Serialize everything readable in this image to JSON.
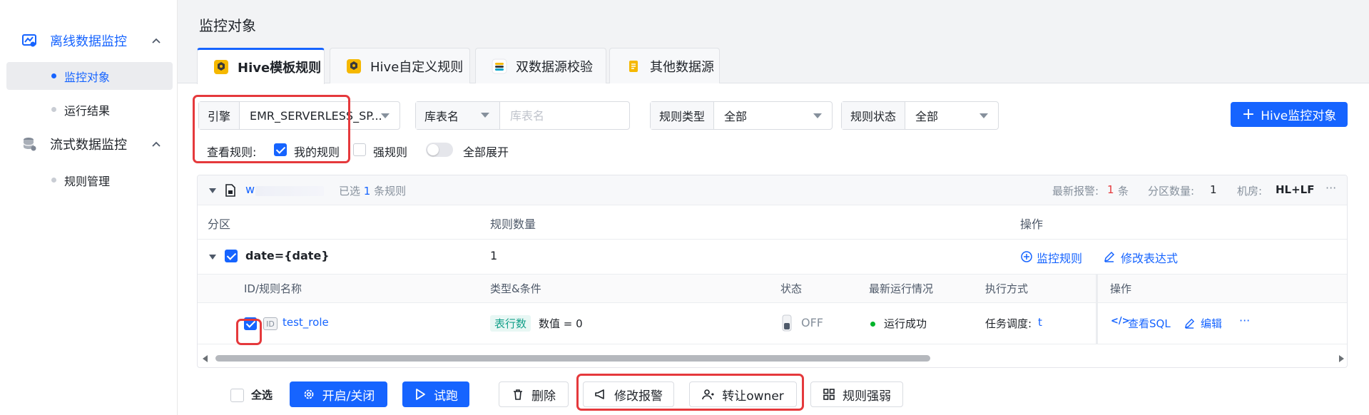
{
  "sidebar": {
    "groups": [
      {
        "label": "离线数据监控",
        "icon": "chart-monitor-icon"
      },
      {
        "label": "流式数据监控",
        "icon": "database-icon"
      }
    ],
    "items": [
      {
        "label": "监控对象"
      },
      {
        "label": "运行结果"
      },
      {
        "label": "规则管理"
      }
    ]
  },
  "page": {
    "title": "监控对象"
  },
  "tabs": [
    {
      "label": "Hive模板规则"
    },
    {
      "label": "Hive自定义规则"
    },
    {
      "label": "双数据源校验"
    },
    {
      "label": "其他数据源"
    }
  ],
  "filters": {
    "engine": {
      "label": "引擎",
      "value": "EMR_SERVERLESS_SP..."
    },
    "table": {
      "label": "库表名",
      "placeholder": "库表名"
    },
    "rule_type": {
      "label": "规则类型",
      "value": "全部"
    },
    "rule_status": {
      "label": "规则状态",
      "value": "全部"
    },
    "view_rules_label": "查看规则:",
    "my_rules": "我的规则",
    "strong_rules": "强规则",
    "expand_all": "全部展开"
  },
  "primary_button": {
    "label": "Hive监控对象"
  },
  "table_card": {
    "name": "w",
    "selected_text_pre": "已选",
    "selected_count": "1",
    "selected_text_post": "条规则",
    "latest_alert_label": "最新报警:",
    "latest_alert_count": "1",
    "latest_alert_unit": "条",
    "partition_count_label": "分区数量:",
    "partition_count": "1",
    "room_label": "机房:",
    "room_value": "HL+LF",
    "more": "···"
  },
  "partition_header": {
    "partition": "分区",
    "rule_count": "规则数量",
    "ops": "操作"
  },
  "partition_row": {
    "partition": "date={date}",
    "rule_count": "1",
    "monitor_rule": "监控规则",
    "edit_expression": "修改表达式"
  },
  "rule_header": {
    "id_name": "ID/规则名称",
    "type_cond": "类型&条件",
    "status": "状态",
    "latest_run": "最新运行情况",
    "exec_mode": "执行方式",
    "ops": "操作"
  },
  "rule_row": {
    "id_badge": "ID",
    "name": "test_role",
    "type_tag": "表行数",
    "condition": "数值 = 0",
    "status": "OFF",
    "run_status": "运行成功",
    "exec_label": "任务调度:",
    "exec_value": "t",
    "view_sql": "查看SQL",
    "edit": "编辑",
    "more": "···"
  },
  "bottom_bar": {
    "select_all": "全选",
    "toggle_on_off": "开启/关闭",
    "trial_run": "试跑",
    "delete": "删除",
    "modify_alert": "修改报警",
    "transfer_owner": "转让owner",
    "rule_strength": "规则强弱"
  },
  "colors": {
    "accent": "#1664ff",
    "success": "#00b42a",
    "alert": "#e5393c",
    "highlight_box": "#e5393c"
  }
}
